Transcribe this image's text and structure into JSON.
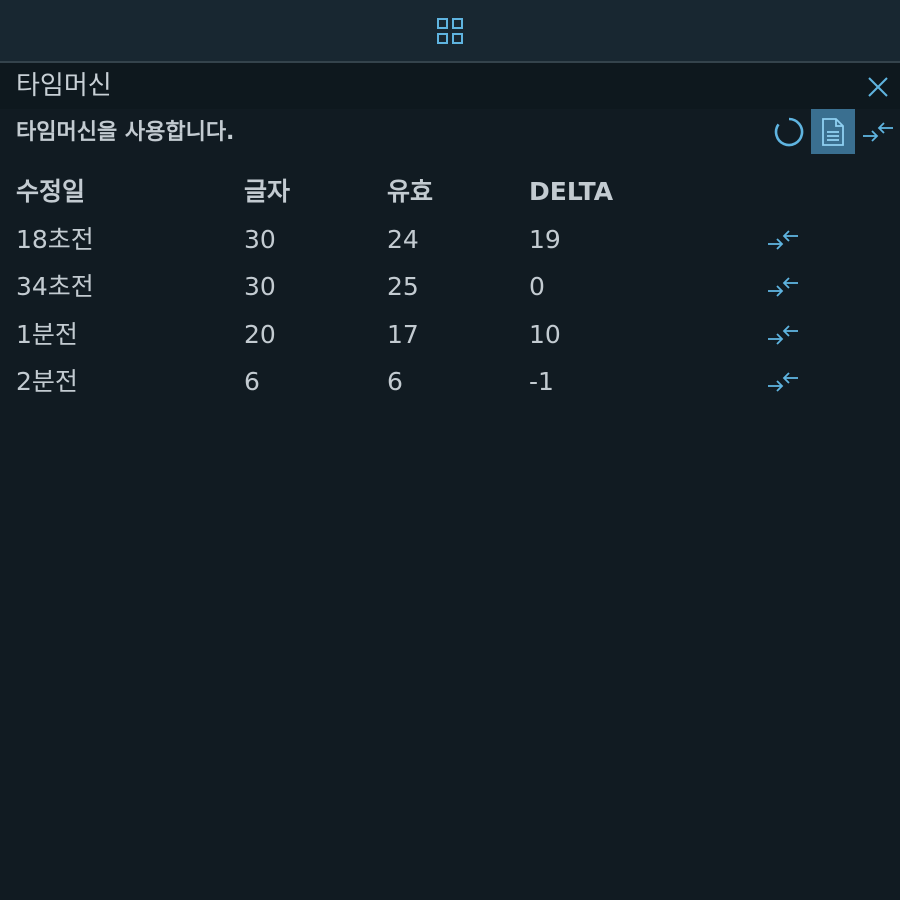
{
  "panel": {
    "title": "타임머신",
    "description": "타임머신을 사용합니다."
  },
  "icons": {
    "top": "grid-icon",
    "close": "close-icon",
    "refresh": "refresh-circle-icon",
    "document": "document-icon",
    "compare": "compare-arrows-icon"
  },
  "colors": {
    "accent": "#5fb4e0",
    "selected_bg": "#3a6f90"
  },
  "table": {
    "headers": [
      "수정일",
      "글자",
      "유효",
      "DELTA"
    ],
    "rows": [
      {
        "modified": "18초전",
        "chars": "30",
        "valid": "24",
        "delta": "19"
      },
      {
        "modified": "34초전",
        "chars": "30",
        "valid": "25",
        "delta": "0"
      },
      {
        "modified": "1분전",
        "chars": "20",
        "valid": "17",
        "delta": "10"
      },
      {
        "modified": "2분전",
        "chars": "6",
        "valid": "6",
        "delta": "-1"
      }
    ]
  }
}
